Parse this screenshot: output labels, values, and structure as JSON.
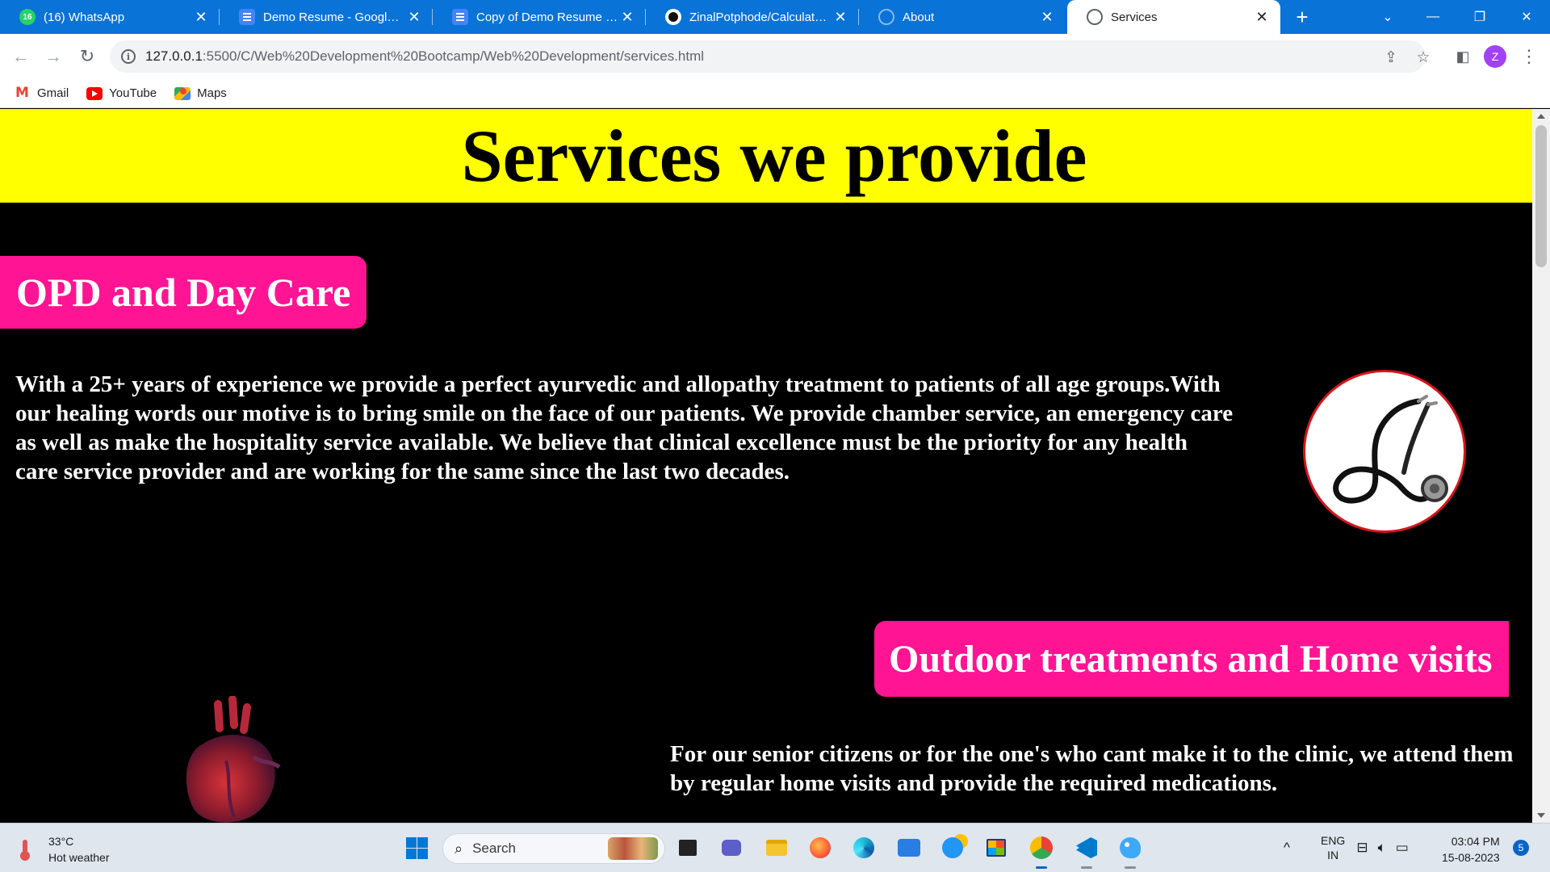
{
  "browser": {
    "tabs": [
      {
        "title": "(16) WhatsApp",
        "favicon": "whatsapp-icon",
        "badge": "16",
        "active": false
      },
      {
        "title": "Demo Resume - Google Docs",
        "favicon": "google-docs-icon",
        "active": false
      },
      {
        "title": "Copy of Demo Resume - Google Docs",
        "favicon": "google-docs-icon",
        "active": false
      },
      {
        "title": "ZinalPotphode/Calculator: T",
        "favicon": "github-icon",
        "active": false
      },
      {
        "title": "About",
        "favicon": "globe-icon",
        "active": false
      },
      {
        "title": "Services",
        "favicon": "globe-icon",
        "active": true
      }
    ],
    "new_tab_label": "+",
    "address": {
      "host": "127.0.0.1",
      "path": ":5500/C/Web%20Development%20Bootcamp/Web%20Development/services.html"
    },
    "profile_initial": "Z",
    "bookmarks": [
      {
        "label": "Gmail",
        "icon": "gmail-icon"
      },
      {
        "label": "YouTube",
        "icon": "youtube-icon"
      },
      {
        "label": "Maps",
        "icon": "maps-icon"
      }
    ]
  },
  "page": {
    "title": "Services we provide",
    "sections": [
      {
        "heading": "OPD and Day Care",
        "text": "With a 25+ years of experience we provide a perfect ayurvedic and allopathy treatment to patients of all age groups.With our healing words our motive is to bring smile on the face of our patients. We provide chamber service, an emergency care as well as make the hospitality service available. We believe that clinical excellence must be the priority for any health care service provider and are working for the same since the last two decades.",
        "image": "stethoscope-image"
      },
      {
        "heading": "Outdoor treatments and Home visits",
        "text": "For our senior citizens or for the one's who cant make it to the clinic, we attend them by regular home visits and provide the required medications.",
        "image": "heart-image"
      }
    ],
    "colors": {
      "header_bg": "#ffff00",
      "pill_bg": "#ff1493",
      "page_bg": "#000000",
      "image_border": "#d8141b"
    }
  },
  "taskbar": {
    "weather": {
      "temp": "33°C",
      "desc": "Hot weather"
    },
    "search_placeholder": "Search",
    "language": {
      "lang": "ENG",
      "region": "IN"
    },
    "time": "03:04 PM",
    "date": "15-08-2023",
    "notifications": "5",
    "apps": [
      "start-icon",
      "search-box",
      "task-view-icon",
      "meet-icon",
      "file-explorer-icon",
      "firefox-icon",
      "edge-icon",
      "myhp-icon",
      "support-icon",
      "store-icon",
      "chrome-icon",
      "vscode-icon",
      "paint-icon"
    ]
  }
}
